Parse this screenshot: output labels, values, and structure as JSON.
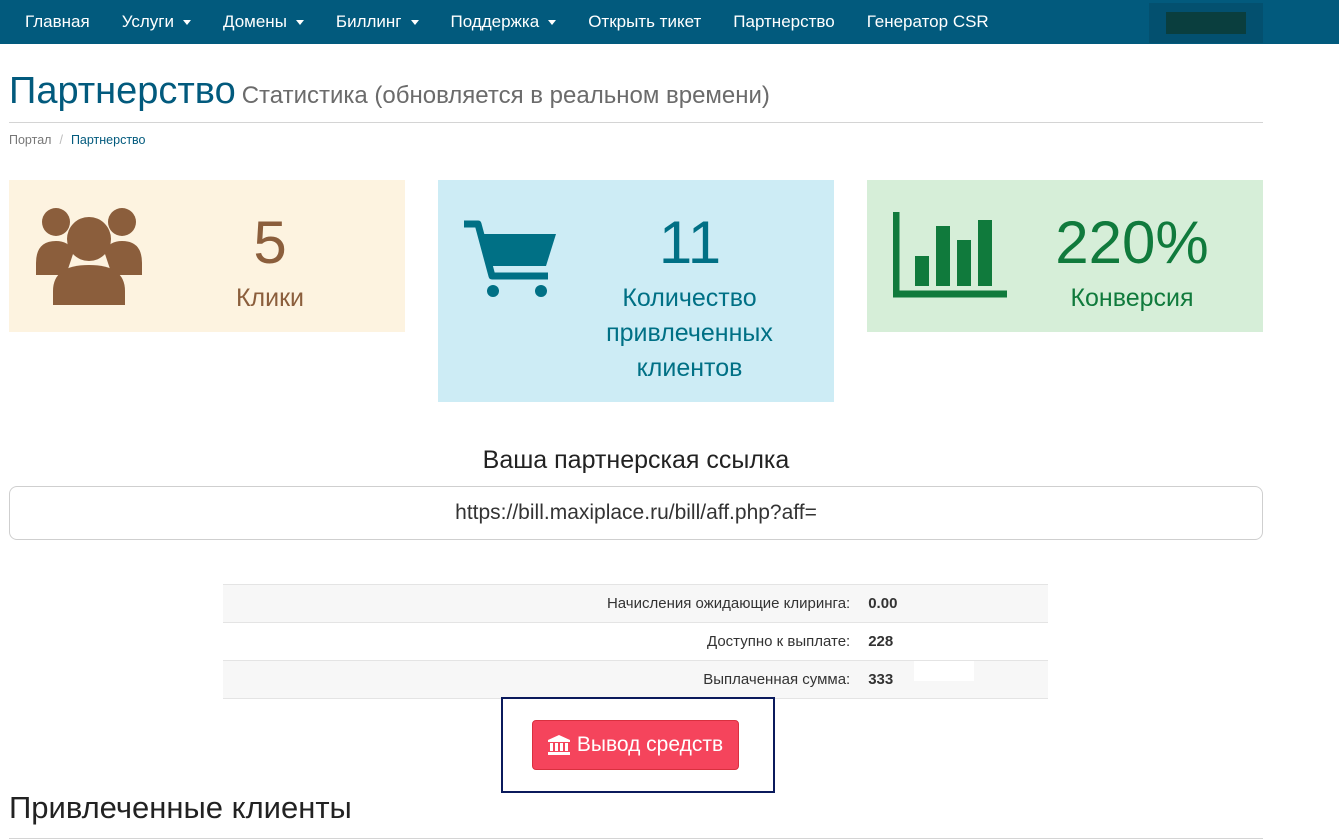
{
  "navbar": {
    "items": [
      {
        "label": "Главная",
        "dropdown": false
      },
      {
        "label": "Услуги",
        "dropdown": true
      },
      {
        "label": "Домены",
        "dropdown": true
      },
      {
        "label": "Биллинг",
        "dropdown": true
      },
      {
        "label": "Поддержка",
        "dropdown": true
      },
      {
        "label": "Открыть тикет",
        "dropdown": false
      },
      {
        "label": "Партнерство",
        "dropdown": false
      },
      {
        "label": "Генератор CSR",
        "dropdown": false
      }
    ]
  },
  "header": {
    "title": "Партнерство",
    "subtitle": "Статистика (обновляется в реальном времени)"
  },
  "breadcrumb": {
    "home": "Портал",
    "separator": "/",
    "current": "Партнерство"
  },
  "stats": {
    "clicks": {
      "value": "5",
      "label": "Клики",
      "icon": "users-icon",
      "color": "#8b5e3c"
    },
    "clients": {
      "value": "11",
      "label": "Количество привлеченных клиентов",
      "icon": "shopping-cart-icon",
      "color": "#007085"
    },
    "conversion": {
      "value": "220%",
      "label": "Конверсия",
      "icon": "bar-chart-icon",
      "color": "#107a3c"
    }
  },
  "affiliate": {
    "heading": "Ваша партнерская ссылка",
    "link": "https://bill.maxiplace.ru/bill/aff.php?aff="
  },
  "balances": [
    {
      "label": "Начисления ожидающие клиринга:",
      "value": "0.00"
    },
    {
      "label": "Доступно к выплате:",
      "value": "228"
    },
    {
      "label": "Выплаченная сумма:",
      "value": "333"
    }
  ],
  "withdraw": {
    "label": "Вывод средств",
    "icon": "bank-icon",
    "color": "#f5445c"
  },
  "referred": {
    "title": "Привлеченные клиенты"
  },
  "colors": {
    "navbar": "#025a7d",
    "accent": "#025a7d"
  }
}
